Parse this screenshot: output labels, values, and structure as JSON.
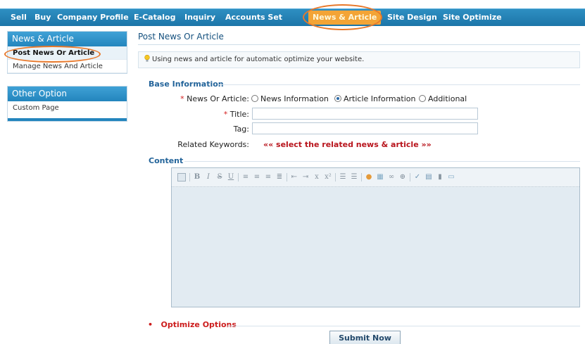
{
  "topnav": {
    "items": [
      {
        "label": "Sell"
      },
      {
        "label": "Buy"
      },
      {
        "label": "Company Profile"
      },
      {
        "label": "E-Catalog"
      },
      {
        "label": "Inquiry"
      },
      {
        "label": "Accounts Set"
      },
      {
        "label": "News & Article"
      },
      {
        "label": "Site Design"
      },
      {
        "label": "Site Optimize"
      }
    ],
    "active": "News & Article"
  },
  "sidebar": {
    "news_box": {
      "title": "News & Article",
      "items": [
        {
          "label": "Post News Or Article"
        },
        {
          "label": "Manage News And Article"
        }
      ]
    },
    "other_box": {
      "title": "Other Option",
      "items": [
        {
          "label": "Custom Page"
        }
      ]
    }
  },
  "main": {
    "title": "Post News Or Article",
    "tip": "Using news and article for automatic optimize your website.",
    "base_section": "Base Information",
    "form": {
      "type_label": "News Or Article:",
      "type_options": [
        {
          "label": "News Information",
          "selected": false
        },
        {
          "label": "Article Information",
          "selected": true
        },
        {
          "label": "Additional",
          "selected": false
        }
      ],
      "title_label": "Title:",
      "title_value": "",
      "tag_label": "Tag:",
      "tag_value": "",
      "related_label": "Related Keywords:",
      "related_link": "«« select the related news & article »»",
      "required_mark": "*"
    },
    "content_section": "Content",
    "editor_toolbar": [
      "source-icon",
      "bold-icon",
      "italic-icon",
      "strikethrough-icon",
      "underline-icon",
      "align-left-icon",
      "align-center-icon",
      "align-right-icon",
      "justify-icon",
      "outdent-icon",
      "indent-icon",
      "subscript-icon",
      "superscript-icon",
      "ordered-list-icon",
      "unordered-list-icon",
      "color-icon",
      "image-icon",
      "link-icon",
      "anchor-icon",
      "spellcheck-icon",
      "table-icon",
      "delete-icon",
      "preview-icon"
    ],
    "optimize_label": "Optimize Options",
    "optimize_bullet": "•",
    "submit_label": "Submit Now"
  },
  "colors": {
    "nav_bg": "#1f7bb0",
    "nav_active": "#f3a436",
    "annotation_ring": "#e8782a",
    "section_heading": "#23649a",
    "required": "#d42020",
    "link": "#b8141c"
  }
}
